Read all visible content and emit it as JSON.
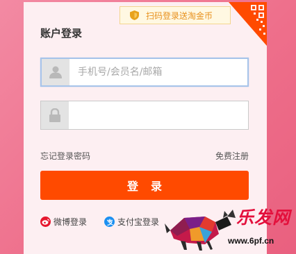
{
  "promo": {
    "text": "扫码登录送淘金币",
    "icon": "shield-icon"
  },
  "login": {
    "title": "账户登录",
    "username": {
      "placeholder": "手机号/会员名/邮箱",
      "value": "",
      "icon": "user-icon"
    },
    "password": {
      "placeholder": "",
      "value": "",
      "icon": "lock-icon"
    },
    "forgot_label": "忘记登录密码",
    "register_label": "免费注册",
    "submit_label": "登录",
    "alt_logins": [
      {
        "label": "微博登录",
        "icon": "weibo-icon"
      },
      {
        "label": "支付宝登录",
        "icon": "alipay-icon"
      }
    ]
  },
  "watermark": {
    "logo_text": "乐发网",
    "url": "www.6pf.cn"
  },
  "colors": {
    "background": "#f07893",
    "panel": "#fdeff2",
    "accent": "#ff4a00",
    "promo_text": "#e8901c"
  }
}
